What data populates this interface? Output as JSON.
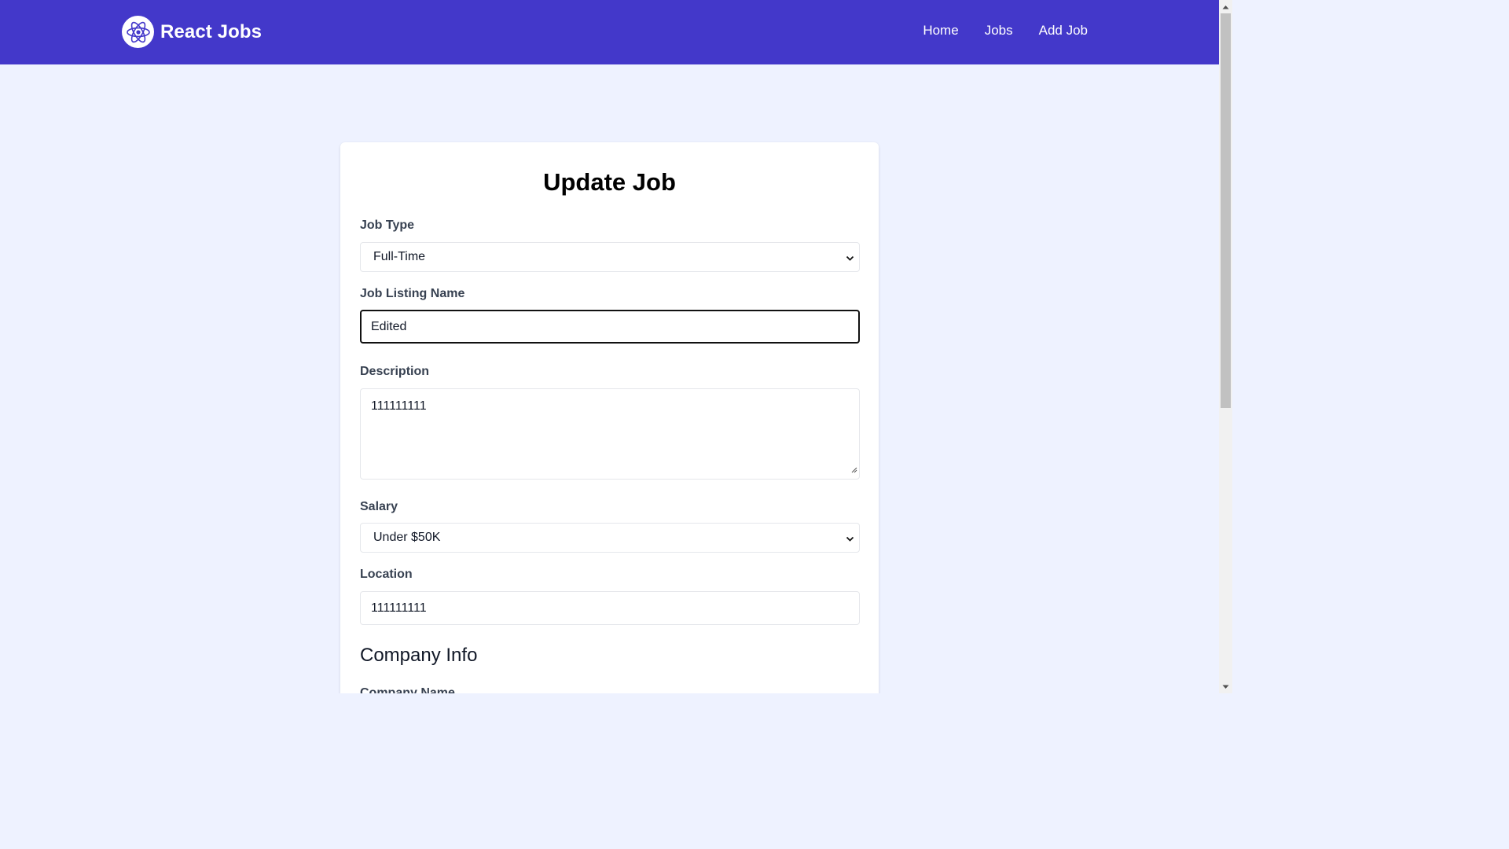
{
  "navbar": {
    "brand": "React Jobs",
    "links": [
      {
        "label": "Home"
      },
      {
        "label": "Jobs"
      },
      {
        "label": "Add Job"
      }
    ]
  },
  "form": {
    "title": "Update Job",
    "job_type": {
      "label": "Job Type",
      "value": "Full-Time"
    },
    "listing_name": {
      "label": "Job Listing Name",
      "value": "Edited"
    },
    "description": {
      "label": "Description",
      "value": "111111111"
    },
    "salary": {
      "label": "Salary",
      "value": "Under $50K"
    },
    "location": {
      "label": "Location",
      "value": "111111111"
    },
    "company_section": {
      "heading": "Company Info",
      "next_label": "Company Name"
    }
  },
  "colors": {
    "navbar_bg": "#4338ca",
    "page_bg": "#eef2ff",
    "card_bg": "#ffffff",
    "label_text": "#374151"
  },
  "icons": {
    "logo": "react-logo-icon",
    "select_arrow": "chevron-down-icon",
    "resize": "resize-handle-icon"
  }
}
